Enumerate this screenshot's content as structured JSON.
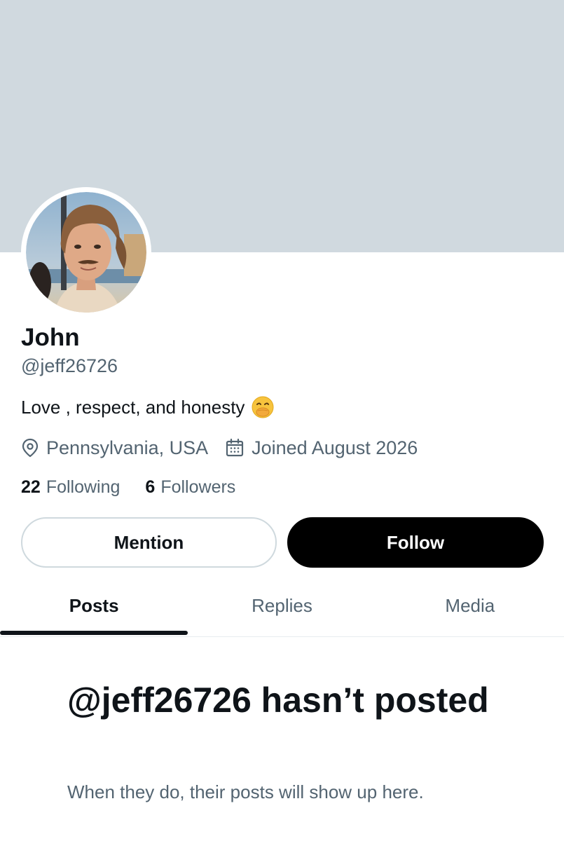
{
  "profile": {
    "display_name": "John",
    "handle": "@jeff26726",
    "bio": "Love , respect, and honesty",
    "bio_emoji": "face-with-hand-over-mouth",
    "location": "Pennsylvania, USA",
    "joined": "Joined August 2026"
  },
  "stats": {
    "following_count": "22",
    "following_label": "Following",
    "followers_count": "6",
    "followers_label": "Followers"
  },
  "actions": {
    "mention_label": "Mention",
    "follow_label": "Follow"
  },
  "tabs": [
    {
      "label": "Posts",
      "active": true
    },
    {
      "label": "Replies",
      "active": false
    },
    {
      "label": "Media",
      "active": false
    }
  ],
  "empty_state": {
    "title": "@jeff26726 hasn’t posted",
    "subtitle": "When they do, their posts will show up here."
  },
  "colors": {
    "banner": "#d0d9df",
    "primary_text": "#0f1419",
    "secondary_text": "#536471",
    "follow_button": "#000000",
    "border": "#cfd9de"
  },
  "icons": {
    "location": "location-pin-icon",
    "joined": "calendar-icon"
  }
}
